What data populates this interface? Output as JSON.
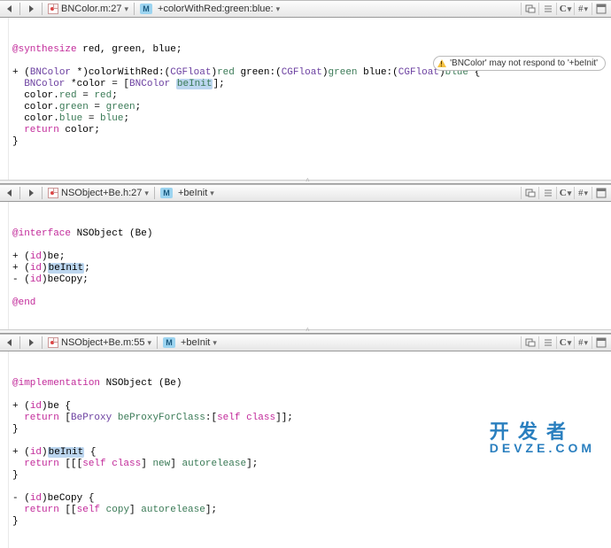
{
  "panes": [
    {
      "file": "BNColor.m:27",
      "method": "+colorWithRed:green:blue:",
      "warning": "'BNColor' may not respond to '+beInit'",
      "code": {
        "l1a": "@synthesize",
        "l1b": " red, green, blue;",
        "l2a": "+ (",
        "l2b": "BNColor",
        "l2c": " *)colorWithRed:(",
        "l2d": "CGFloat",
        "l2e": ")",
        "l2f": "red",
        "l2g": " green:(",
        "l2h": "CGFloat",
        "l2i": ")",
        "l2j": "green",
        "l2k": " blue:(",
        "l2l": "CGFloat",
        "l2m": ")",
        "l2n": "blue",
        "l2o": " {",
        "l3a": "BNColor",
        "l3b": " *color = [",
        "l3c": "BNColor",
        "l3d": " ",
        "l3e": "beInit",
        "l3f": "];",
        "l4a": "  color.",
        "l4b": "red",
        "l4c": " = ",
        "l4d": "red",
        "l4e": ";",
        "l5a": "  color.",
        "l5b": "green",
        "l5c": " = ",
        "l5d": "green",
        "l5e": ";",
        "l6a": "  color.",
        "l6b": "blue",
        "l6c": " = ",
        "l6d": "blue",
        "l6e": ";",
        "l7a": "  ",
        "l7b": "return",
        "l7c": " color;",
        "l8": "}"
      }
    },
    {
      "file": "NSObject+Be.h:27",
      "method": "+beInit",
      "code": {
        "l1a": "@interface",
        "l1b": " NSObject (Be)",
        "l2a": "+ (",
        "l2b": "id",
        "l2c": ")be;",
        "l3a": "+ (",
        "l3b": "id",
        "l3c": ")",
        "l3d": "beInit",
        "l3e": ";",
        "l4a": "- (",
        "l4b": "id",
        "l4c": ")beCopy;",
        "l5": "@end"
      }
    },
    {
      "file": "NSObject+Be.m:55",
      "method": "+beInit",
      "code": {
        "l1a": "@implementation",
        "l1b": " NSObject (Be)",
        "l2a": "+ (",
        "l2b": "id",
        "l2c": ")be {",
        "l3a": "  ",
        "l3b": "return",
        "l3c": " [",
        "l3d": "BeProxy",
        "l3e": " ",
        "l3f": "beProxyForClass",
        "l3g": ":[",
        "l3h": "self",
        "l3i": " ",
        "l3j": "class",
        "l3k": "]];",
        "l4": "}",
        "l5a": "+ (",
        "l5b": "id",
        "l5c": ")",
        "l5d": "beInit",
        "l5e": " {",
        "l6a": "  ",
        "l6b": "return",
        "l6c": " [[[",
        "l6d": "self",
        "l6e": " ",
        "l6f": "class",
        "l6g": "] ",
        "l6h": "new",
        "l6i": "] ",
        "l6j": "autorelease",
        "l6k": "];",
        "l7": "}",
        "l8a": "- (",
        "l8b": "id",
        "l8c": ")beCopy {",
        "l9a": "  ",
        "l9b": "return",
        "l9c": " [[",
        "l9d": "self",
        "l9e": " ",
        "l9f": "copy",
        "l9g": "] ",
        "l9h": "autorelease",
        "l9i": "];",
        "l10": "}"
      }
    }
  ],
  "watermark": {
    "cn": "开 发 者",
    "en": "DEVZE.COM"
  },
  "labels": {
    "C": "C",
    "hash": "#"
  }
}
